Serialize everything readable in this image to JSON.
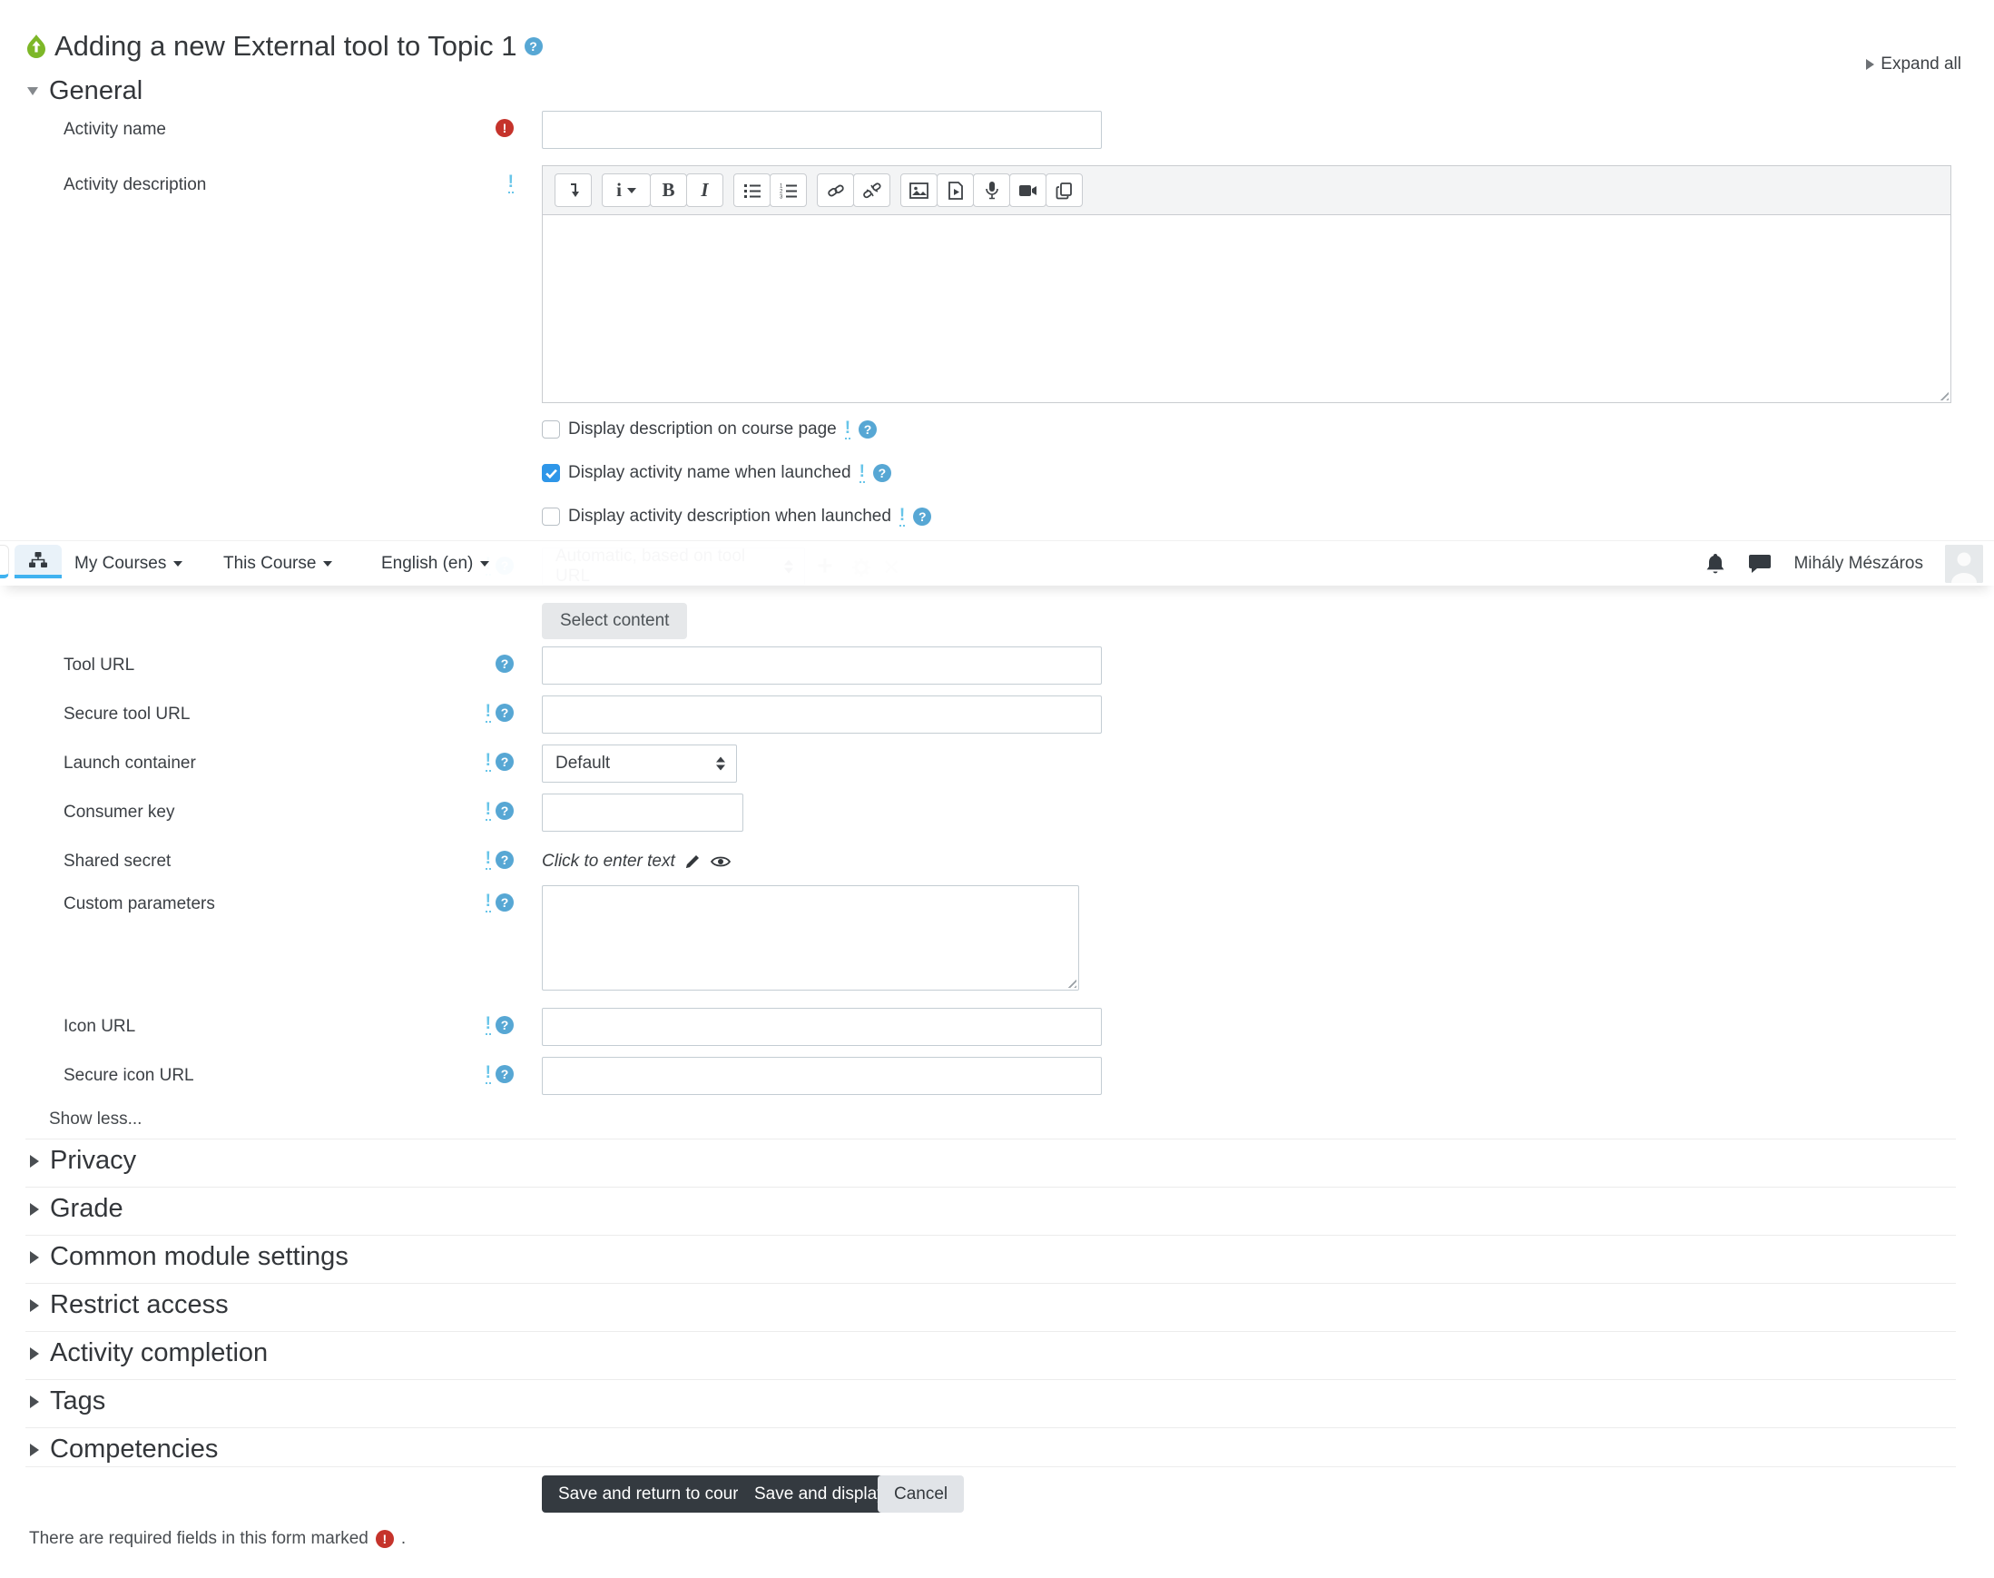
{
  "header": {
    "title": "Adding a new External tool to Topic 1",
    "expand_all": "Expand all"
  },
  "navbar": {
    "menus": [
      "My Courses",
      "This Course",
      "English (en)"
    ],
    "user_name": "Mihály Mészáros"
  },
  "general": {
    "heading": "General"
  },
  "fields": {
    "activity_name": {
      "label": "Activity name"
    },
    "activity_description": {
      "label": "Activity description"
    },
    "preconfigured_tool": {
      "select_value": "Automatic, based on tool URL",
      "select_button": "Select content"
    },
    "tool_url": {
      "label": "Tool URL"
    },
    "secure_tool_url": {
      "label": "Secure tool URL"
    },
    "launch_container": {
      "label": "Launch container",
      "select_value": "Default"
    },
    "consumer_key": {
      "label": "Consumer key"
    },
    "shared_secret": {
      "label": "Shared secret",
      "value_text": "Click to enter text"
    },
    "custom_parameters": {
      "label": "Custom parameters"
    },
    "icon_url": {
      "label": "Icon URL"
    },
    "secure_icon_url": {
      "label": "Secure icon URL"
    }
  },
  "checkboxes": [
    {
      "label": "Display description on course page",
      "checked": false
    },
    {
      "label": "Display activity name when launched",
      "checked": true
    },
    {
      "label": "Display activity description when launched",
      "checked": false
    }
  ],
  "show_less": "Show less...",
  "collapsed_sections": [
    "Privacy",
    "Grade",
    "Common module settings",
    "Restrict access",
    "Activity completion",
    "Tags",
    "Competencies"
  ],
  "buttons": {
    "save_return": "Save and return to course",
    "save_display": "Save and display",
    "cancel": "Cancel"
  },
  "footer": {
    "required_note": "There are required fields in this form marked",
    "suffix": "."
  },
  "editor_glyphs": {
    "styles": "i",
    "bold": "B",
    "italic": "I"
  },
  "colors": {
    "primary_checkbox_blue": "#2e96e8",
    "help_icon_blue": "#57a7d4",
    "advanced_icon_blue": "#68c5e9",
    "required_red": "#c5332b",
    "dark_button": "#343a40",
    "tab_underline_blue": "#3fb2f0",
    "activity_icon_green": "#7db728"
  }
}
